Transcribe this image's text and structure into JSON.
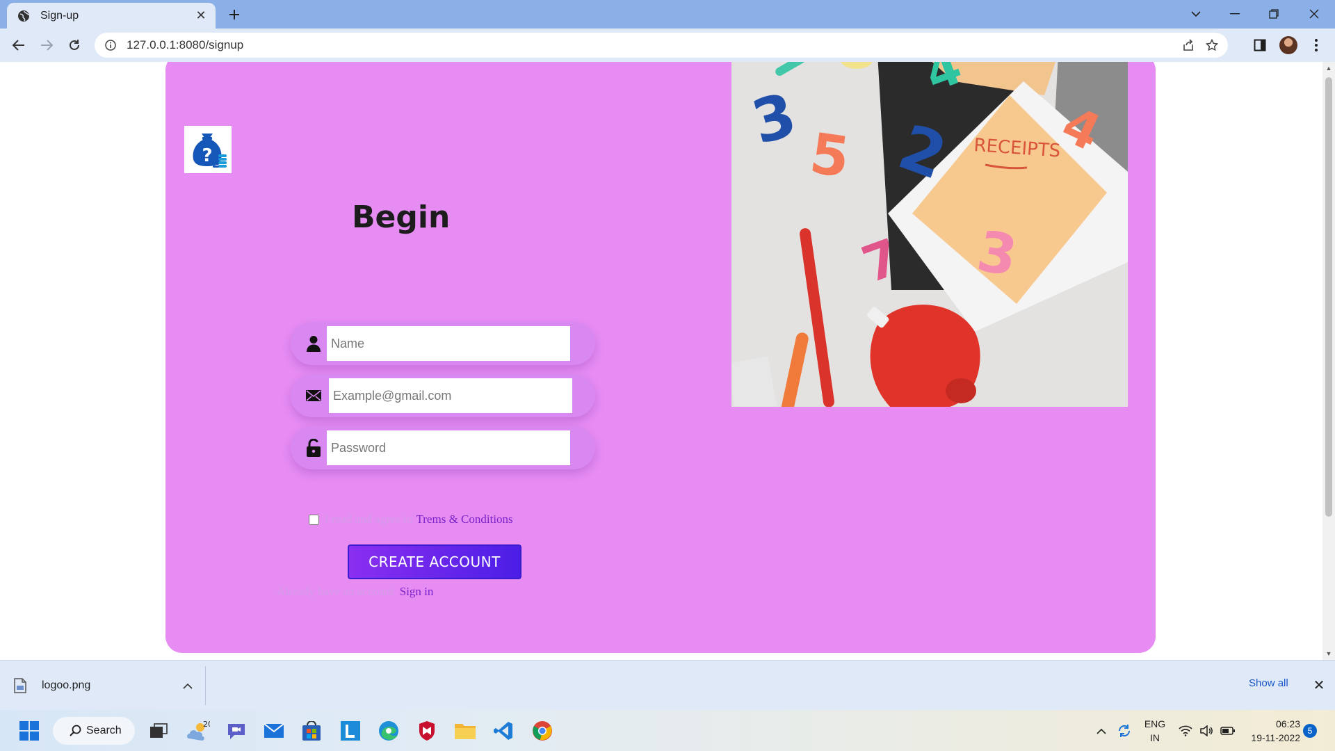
{
  "browser": {
    "tab_title": "Sign-up",
    "url": "127.0.0.1:8080/signup",
    "icons": {
      "tab_favicon": "globe-icon",
      "back": "arrow-left-icon",
      "forward": "arrow-right-icon",
      "reload": "reload-icon",
      "site_info": "info-icon",
      "share": "share-icon",
      "bookmark": "star-icon",
      "side_panel": "side-panel-icon",
      "profile": "avatar",
      "menu": "kebab-icon"
    }
  },
  "page": {
    "title": "Begin",
    "logo_icon": "money-bag-question-icon",
    "fields": {
      "name_placeholder": "Name",
      "email_placeholder": "Example@gmail.com",
      "password_placeholder": "Password"
    },
    "terms_text": "I read and agree to",
    "terms_link": "Trems & Conditions",
    "create_button": "CREATE ACCOUNT",
    "signin_text": "Already have an account",
    "signin_link": "Sign in",
    "hero_text": "RECEIPTS",
    "colors": {
      "card_bg": "#e68cf3",
      "button_start": "#8b2ff0",
      "button_end": "#4b1ee6",
      "link": "#7a22c8"
    }
  },
  "downloads": {
    "file_name": "logoo.png",
    "show_all": "Show all"
  },
  "taskbar": {
    "search_label": "Search",
    "weather_temp": "20°",
    "lang_line1": "ENG",
    "lang_line2": "IN",
    "time": "06:23",
    "date": "19-11-2022",
    "notification_count": "5"
  }
}
